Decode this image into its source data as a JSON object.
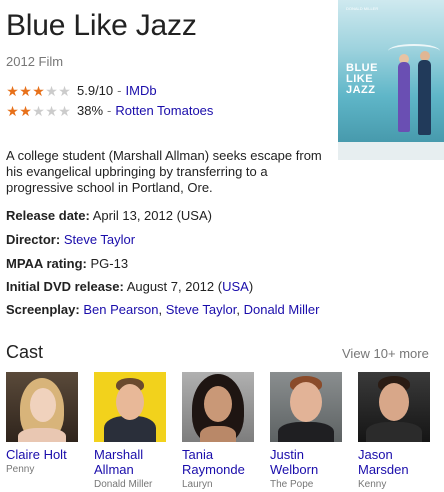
{
  "header": {
    "title": "Blue Like Jazz",
    "subtitle": "2012 Film"
  },
  "ratings": [
    {
      "stars": 3,
      "max": 5,
      "score": "5.9/10",
      "dash": "-",
      "source": "IMDb"
    },
    {
      "stars": 2,
      "max": 5,
      "score": "38%",
      "dash": "-",
      "source": "Rotten Tomatoes"
    }
  ],
  "poster": {
    "title_line1": "BLUE",
    "title_line2": "LIKE",
    "title_line3": "JAZZ",
    "credit_name": "DONALD MILLER"
  },
  "description": "A college student (Marshall Allman) seeks escape from his evangelical upbringing by transferring to a progressive school in Portland, Ore.",
  "facts": {
    "release_label": "Release date:",
    "release_value": "April 13, 2012",
    "release_country": "(USA)",
    "director_label": "Director:",
    "director_value": "Steve Taylor",
    "mpaa_label": "MPAA rating:",
    "mpaa_value": "PG-13",
    "dvd_label": "Initial DVD release:",
    "dvd_value": "August 7, 2012",
    "dvd_country_open": "(",
    "dvd_country": "USA",
    "dvd_country_close": ")",
    "screenplay_label": "Screenplay:",
    "screenplay_1": "Ben Pearson",
    "screenplay_2": "Steve Taylor",
    "screenplay_3": "Donald Miller",
    "sep": ","
  },
  "cast": {
    "title": "Cast",
    "view_more": "View 10+ more",
    "members": [
      {
        "name_line1": "Claire Holt",
        "name_line2": "",
        "role": "Penny"
      },
      {
        "name_line1": "Marshall",
        "name_line2": "Allman",
        "role": "Donald Miller"
      },
      {
        "name_line1": "Tania",
        "name_line2": "Raymonde",
        "role": "Lauryn"
      },
      {
        "name_line1": "Justin",
        "name_line2": "Welborn",
        "role": "The Pope"
      },
      {
        "name_line1": "Jason",
        "name_line2": "Marsden",
        "role": "Kenny"
      }
    ]
  },
  "colors": {
    "link": "#1a0dab",
    "star": "#e7711b",
    "muted": "#777777"
  }
}
